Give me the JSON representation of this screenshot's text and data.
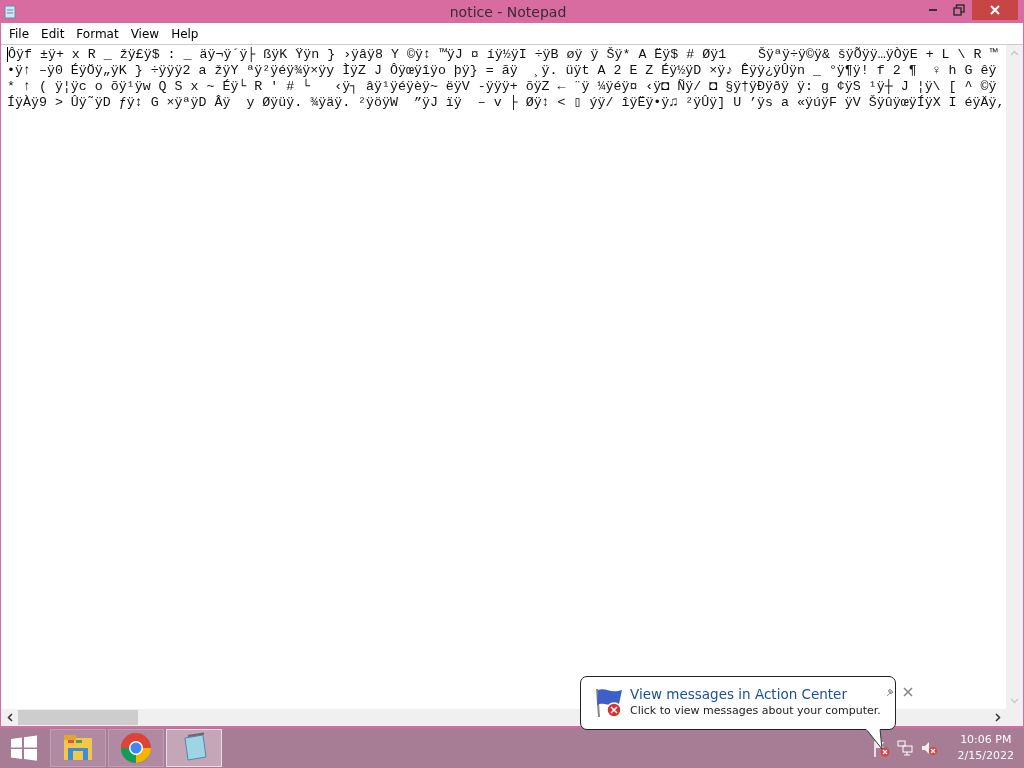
{
  "window": {
    "title": "notice - Notepad"
  },
  "menu": [
    "File",
    "Edit",
    "Format",
    "View",
    "Help"
  ],
  "editor": {
    "lines": [
      "Ôÿf ±ÿ+ x R _ žÿ£ÿ$ : _ äÿ¬ÿ´ÿ├ ßÿK Ÿÿn } ›ÿâÿ8 Y ©ÿ↕ ™ÿJ ¤ íÿ½ÿI ÷ÿB øÿ ÿ Šÿ* A Ëÿ$ # Øÿ1    Šÿªÿ÷ÿ©ÿ& šÿÕÿÿ…ÿÒÿE + L \\ R ™",
      "•ÿ↑ –ÿ0 ÉÿÖÿ„ÿK } ÷ÿÿÿ2 a žÿY ªÿ²ÿéÿ¾ÿ×ÿy ÌÿZ J Ôÿœÿîÿo þÿ} = ãÿ  ¸ÿ. üÿt A 2 E Z Éÿ½ÿD ×ÿ♪ Êÿÿ¿ÿÛÿn _ °ÿ¶ÿ! f 2 ¶  ♀ h G êÿ",
      "* ↑ ( ÿ¦ÿc o õÿ¹ÿw Q S x ~ Éÿ└ R ' # └   ‹ÿ┐ âÿ¹ÿéÿèÿ~ ëÿV -ÿÿÿ+ õÿZ ← ¨ÿ ¼ÿéÿ¤ ‹ÿ◘ Ñÿ/ ◘ §ÿ†ÿÐÿðÿ ÿ: g ¢ÿS ¹ÿ┼ J ¦ÿ\\ [ ^ ©ÿ",
      "ÍÿÀÿ9 > Ûÿ˜ÿD ƒÿ↕ G ×ÿªÿD Âÿ  y Øÿüÿ. ¾ÿäÿ. ²ÿöÿW  ”ÿJ ïÿ  – v ├ Øÿ↕ < ▯ ýÿ/ îÿËÿ•ÿ♫ ²ÿÛÿ] U ’ÿs a «ÿúÿF ÿV ŠÿûÿœÿÍÿX I éÿÄÿ,"
    ]
  },
  "taskbar": {
    "apps": [
      {
        "kind": "explorer",
        "selected": false
      },
      {
        "kind": "chrome",
        "selected": false
      },
      {
        "kind": "notepad",
        "selected": true
      }
    ],
    "time": "10:06 PM",
    "date": "2/15/2022"
  },
  "notification": {
    "title": "View messages in Action Center",
    "message": "Click to view messages about your computer."
  }
}
